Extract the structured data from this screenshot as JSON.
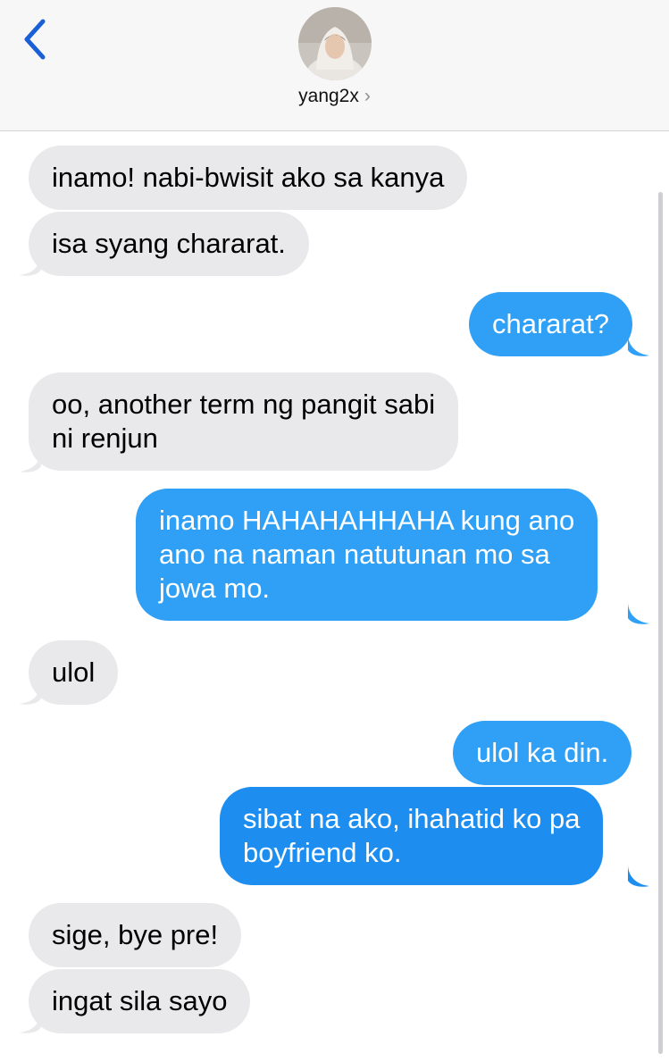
{
  "header": {
    "contact_name": "yang2x",
    "chevron": "›",
    "back_icon": "chevron-left-icon",
    "accent_color": "#1a5fd6"
  },
  "messages": [
    {
      "from": "them",
      "text": "inamo! nabi-bwisit ako sa kanya"
    },
    {
      "from": "them",
      "text": "isa syang chararat."
    },
    {
      "from": "me",
      "text": "chararat?"
    },
    {
      "from": "them",
      "lines": [
        "oo, another term ng pangit sabi",
        "ni renjun"
      ]
    },
    {
      "from": "me",
      "lines": [
        "inamo HAHAHAHHAHA kung ano",
        "ano na naman natutunan mo sa",
        "jowa mo."
      ]
    },
    {
      "from": "them",
      "text": "ulol"
    },
    {
      "from": "me",
      "text": "ulol ka din."
    },
    {
      "from": "me",
      "lines": [
        "sibat na ako, ihahatid ko pa",
        "boyfriend ko."
      ]
    },
    {
      "from": "them",
      "text": "sige, bye pre!"
    },
    {
      "from": "them",
      "text": "ingat sila sayo"
    }
  ],
  "colors": {
    "received_bubble": "#e9e9eb",
    "sent_bubble": "#2fa0f5",
    "sent_bubble_bottom": "#1d8ef0",
    "header_bg": "#f7f7f7"
  }
}
